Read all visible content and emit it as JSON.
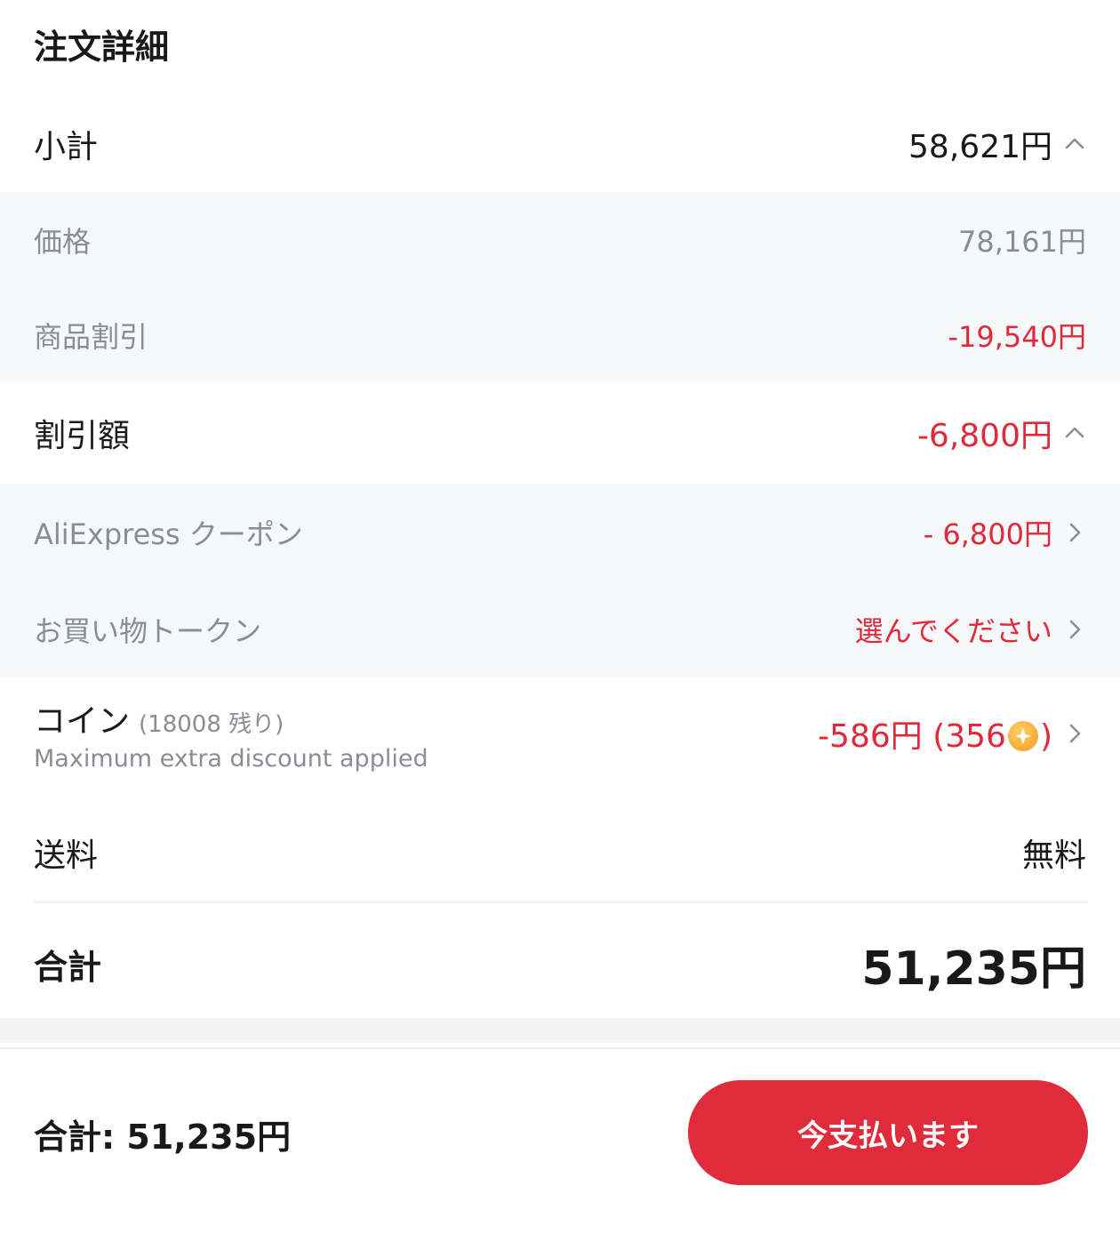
{
  "header": {
    "title": "注文詳細"
  },
  "subtotal": {
    "label": "小計",
    "value": "58,621円",
    "items": [
      {
        "label": "価格",
        "value": "78,161円"
      },
      {
        "label": "商品割引",
        "value": "-19,540円"
      }
    ]
  },
  "discount": {
    "label": "割引額",
    "value": "-6,800円",
    "items": [
      {
        "label": "AliExpress クーポン",
        "value": "- 6,800円"
      },
      {
        "label": "お買い物トークン",
        "value": "選んでください"
      }
    ]
  },
  "coins": {
    "label": "コイン",
    "remaining": "(18008 残り)",
    "note": "Maximum extra discount applied",
    "value_prefix": "-586円 (356",
    "value_suffix": ")"
  },
  "shipping": {
    "label": "送料",
    "value": "無料"
  },
  "total": {
    "label": "合計",
    "value": "51,235円"
  },
  "footer": {
    "total_text": "合計: 51,235円",
    "pay_label": "今支払います"
  },
  "colors": {
    "accent": "#e02b3c",
    "discount_red": "#e0293a",
    "muted": "#8a8d94",
    "sub_bg": "#f7f8fa"
  }
}
